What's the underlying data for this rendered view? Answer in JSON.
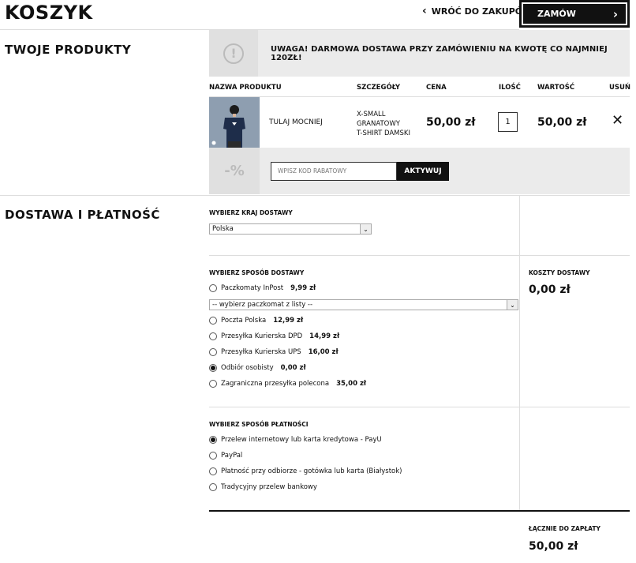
{
  "header": {
    "title": "KOSZYK",
    "back_label": "WRÓĆ DO ZAKUPÓW",
    "order_label": "ZAMÓW"
  },
  "products": {
    "section_title": "TWOJE PRODUKTY",
    "notice": "UWAGA! DARMOWA DOSTAWA PRZY ZAMÓWIENIU NA KWOTĘ CO NAJMNIEJ 120ZŁ!",
    "columns": {
      "name": "NAZWA PRODUKTU",
      "details": "SZCZEGÓŁY",
      "price": "CENA",
      "qty": "ILOŚĆ",
      "value": "WARTOŚĆ",
      "remove": "USUŃ"
    },
    "items": [
      {
        "name": "TULAJ MOCNIEJ",
        "details": [
          "X-SMALL",
          "GRANATOWY",
          "T-SHIRT DAMSKI"
        ],
        "price": "50,00 zł",
        "qty": "1",
        "value": "50,00 zł"
      }
    ],
    "coupon": {
      "icon_text": "-%",
      "placeholder": "WPISZ KOD RABATOWY",
      "button": "AKTYWUJ"
    }
  },
  "delivery": {
    "section_title": "DOSTAWA I PŁATNOŚĆ",
    "country_label": "WYBIERZ KRAJ DOSTAWY",
    "country_value": "Polska",
    "method_label": "WYBIERZ SPOSÓB DOSTAWY",
    "locker_select": "-- wybierz paczkomat z listy --",
    "methods": [
      {
        "label": "Paczkomaty InPost",
        "price": "9,99 zł",
        "selected": false
      },
      {
        "label": "Poczta Polska",
        "price": "12,99 zł",
        "selected": false
      },
      {
        "label": "Przesyłka Kurierska DPD",
        "price": "14,99 zł",
        "selected": false
      },
      {
        "label": "Przesyłka Kurierska UPS",
        "price": "16,00 zł",
        "selected": false
      },
      {
        "label": "Odbiór osobisty",
        "price": "0,00 zł",
        "selected": true
      },
      {
        "label": "Zagraniczna przesyłka polecona",
        "price": "35,00 zł",
        "selected": false
      }
    ],
    "cost_label": "KOSZTY DOSTAWY",
    "cost_value": "0,00 zł",
    "payment_label": "WYBIERZ SPOSÓB PŁATNOŚCI",
    "payments": [
      {
        "label": "Przelew internetowy lub karta kredytowa - PayU",
        "selected": true
      },
      {
        "label": "PayPal",
        "selected": false
      },
      {
        "label": "Płatność przy odbiorze - gotówka lub karta (Białystok)",
        "selected": false
      },
      {
        "label": "Tradycyjny przelew bankowy",
        "selected": false
      }
    ]
  },
  "summary": {
    "total_label": "ŁĄCZNIE DO ZAPŁATY",
    "total_value": "50,00 zł"
  }
}
